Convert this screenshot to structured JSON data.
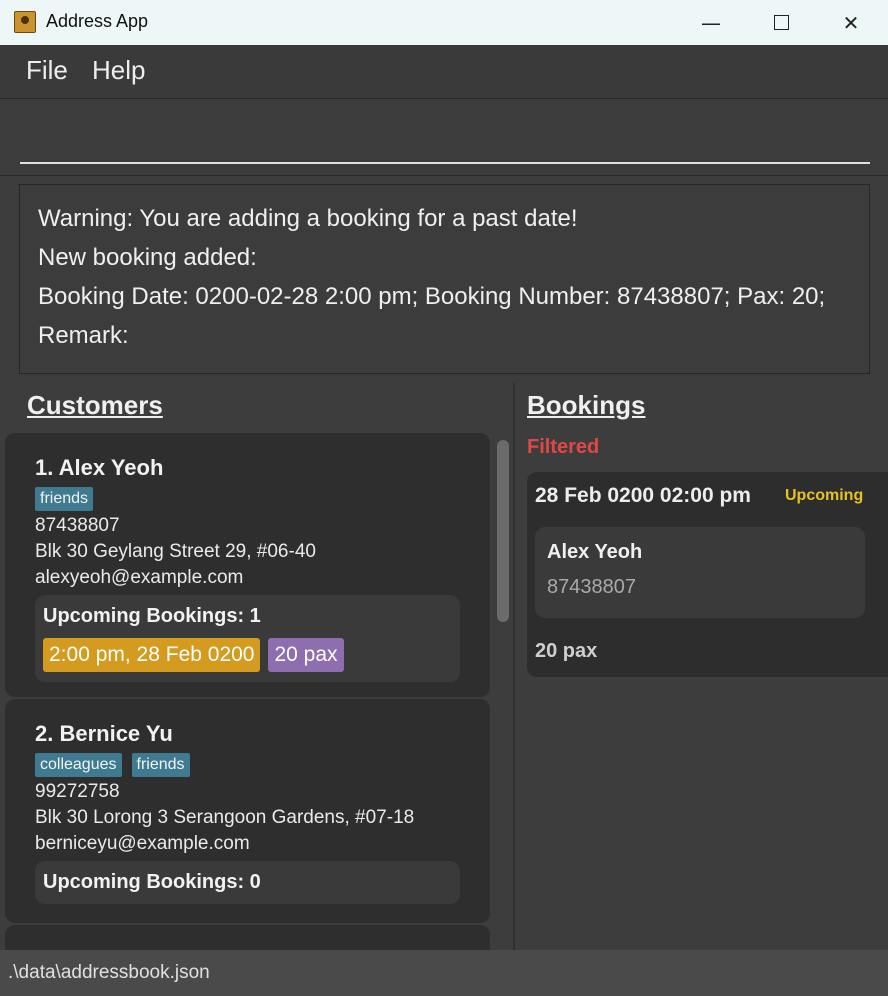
{
  "window": {
    "title": "Address App",
    "icon": "address-book-icon",
    "minimize_glyph": "—",
    "close_glyph": "✕"
  },
  "menu": {
    "items": [
      "File",
      "Help"
    ]
  },
  "command_box": {
    "value": "",
    "placeholder": ""
  },
  "result": {
    "lines": [
      "Warning: You are adding a booking for a past date!",
      "New booking added:",
      "Booking Date: 0200-02-28 2:00 pm; Booking Number: 87438807; Pax: 20;",
      "Remark:"
    ]
  },
  "customers_panel": {
    "title": "Customers",
    "customers": [
      {
        "name": "1. Alex Yeoh",
        "tags": [
          "friends"
        ],
        "phone": "87438807",
        "address": "Blk 30 Geylang Street 29, #06-40",
        "email": "alexyeoh@example.com",
        "upcoming_label": "Upcoming Bookings:  1",
        "booking_date": "2:00 pm, 28 Feb 0200",
        "booking_pax": "20 pax"
      },
      {
        "name": "2. Bernice Yu",
        "tags": [
          "colleagues",
          "friends"
        ],
        "phone": "99272758",
        "address": "Blk 30 Lorong 3 Serangoon Gardens, #07-18",
        "email": "berniceyu@example.com",
        "upcoming_label": "Upcoming Bookings:  0"
      }
    ]
  },
  "bookings_panel": {
    "title": "Bookings",
    "filter_label": "Filtered",
    "booking": {
      "datetime": "28 Feb 0200 02:00 pm",
      "status": "Upcoming",
      "customer_name": "Alex Yeoh",
      "customer_phone": "87438807",
      "pax": "20 pax"
    }
  },
  "status_bar": {
    "path": ".\\data\\addressbook.json"
  },
  "colors": {
    "tag": "#3e7b91",
    "date_chip": "#d49b1f",
    "pax_chip": "#8f6eb0",
    "filtered": "#e04848",
    "upcoming": "#e6c21f"
  }
}
